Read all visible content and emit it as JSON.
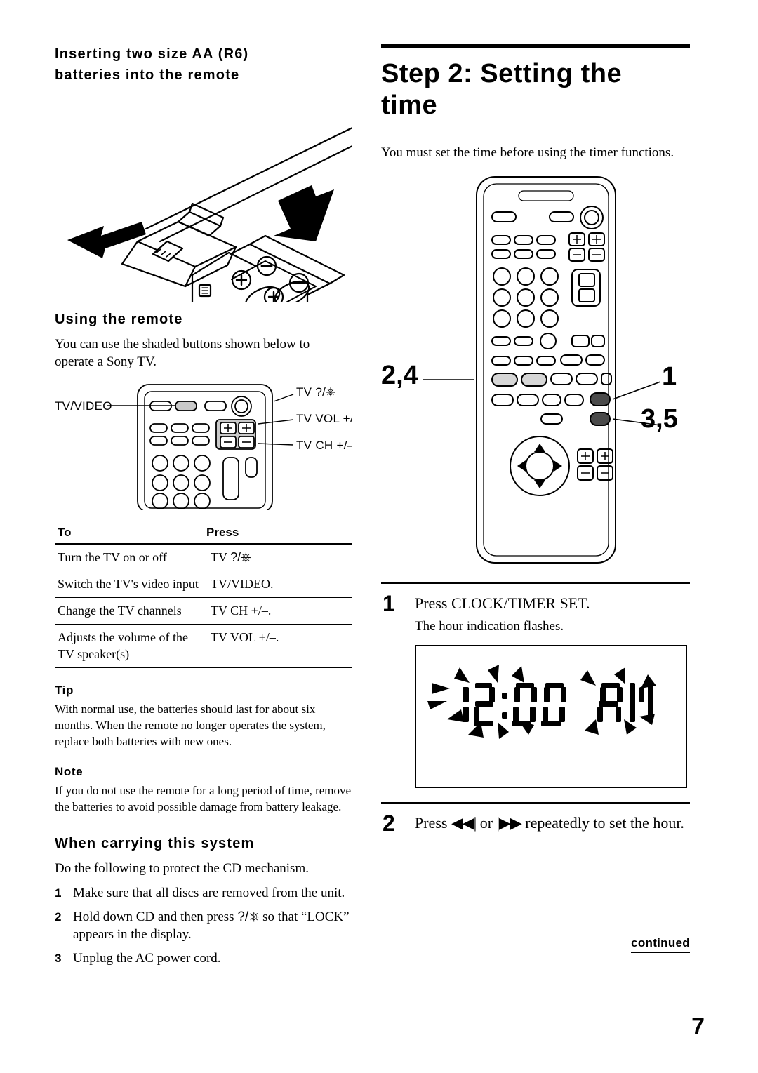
{
  "page": {
    "number": "7",
    "continued_label": "continued"
  },
  "left": {
    "insert_heading": "Inserting two size AA (R6) batteries into the remote",
    "using_remote_heading": "Using the remote",
    "using_remote_text": "You can use the shaded buttons shown below to operate a Sony TV.",
    "remote_labels": {
      "tv_video": "TV/VIDEO",
      "tv_power": "TV ?/1",
      "tv_vol": "TV VOL +/–",
      "tv_ch": "TV CH +/–"
    },
    "table": {
      "headers": [
        "To",
        "Press"
      ],
      "rows": [
        [
          "Turn the TV on or off",
          "TV ?/1"
        ],
        [
          "Switch the TV's video input",
          "TV/VIDEO."
        ],
        [
          "Change the TV channels",
          "TV CH +/–."
        ],
        [
          "Adjusts the volume of the TV speaker(s)",
          "TV VOL +/–."
        ]
      ]
    },
    "tip_heading": "Tip",
    "tip_body": "With normal use, the batteries should last for about six months.  When the remote no longer operates the system, replace both batteries with new ones.",
    "note_heading": "Note",
    "note_body": "If you do not use the remote for a long period of time, remove the batteries to avoid possible damage from battery leakage.",
    "carrying_heading": "When carrying this system",
    "carrying_text": "Do the following to protect the CD mechanism.",
    "carrying_steps": [
      {
        "num": "1",
        "text": "Make sure that all discs are removed from the unit."
      },
      {
        "num": "2",
        "text": "Hold down CD and then press ?/1 so that “LOCK” appears in the display."
      },
      {
        "num": "3",
        "text": "Unplug the AC power cord."
      }
    ]
  },
  "right": {
    "step_title": "Step 2: Setting the time",
    "intro_text": "You must set the time before using the timer functions.",
    "callouts": {
      "left": "2,4",
      "right_top": "1",
      "right_bottom": "3,5"
    },
    "step1": {
      "num": "1",
      "text": "Press CLOCK/TIMER SET.",
      "sub": "The hour indication flashes."
    },
    "display": {
      "time": "12:00",
      "meridiem": "AM"
    },
    "step2": {
      "num": "2",
      "text_before": "Press",
      "text_middle": "or",
      "text_after": "repeatedly to set the hour."
    }
  }
}
